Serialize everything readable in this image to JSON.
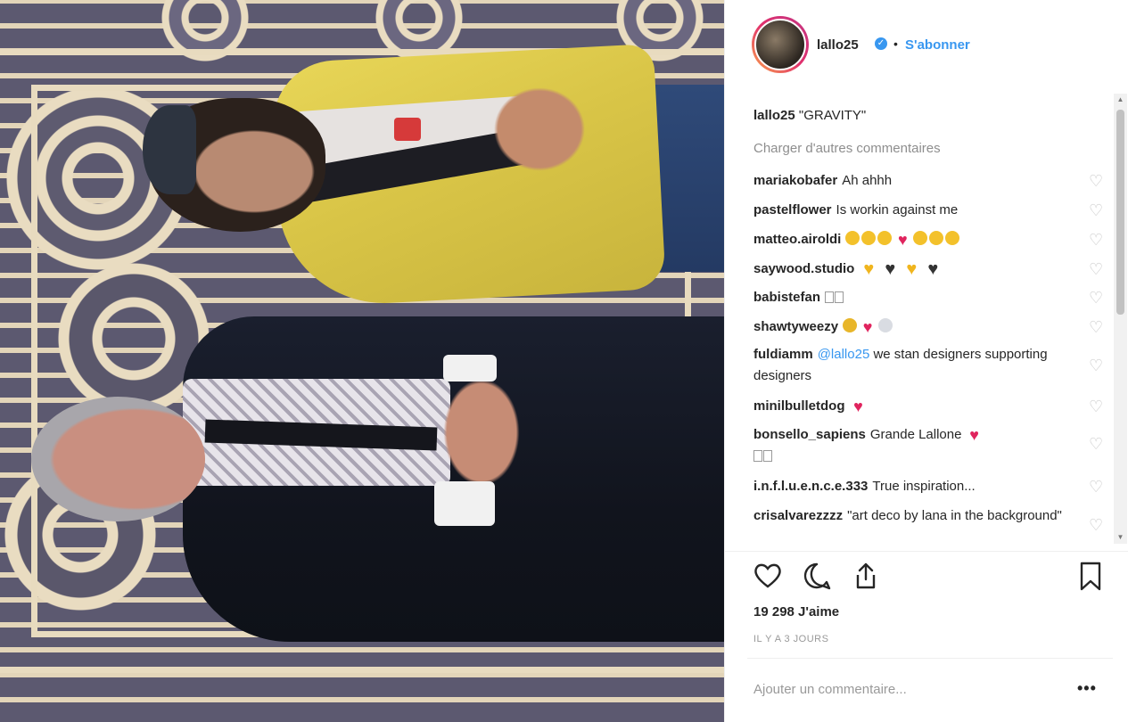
{
  "post": {
    "username": "lallo25",
    "verified_mark": "✓",
    "separator": "•",
    "follow_label": "S'abonner",
    "caption_user": "lallo25",
    "caption_text": "\"GRAVITY\"",
    "load_more": "Charger d'autres commentaires",
    "likes": "19 298 J'aime",
    "time_ago": "IL Y A 3 JOURS",
    "add_comment_placeholder": "Ajouter un commentaire...",
    "more_options": "•••"
  },
  "comments": [
    {
      "user": "mariakobafer",
      "text": "Ah ahhh"
    },
    {
      "user": "pastelflower",
      "text": "Is workin against me"
    },
    {
      "user": "matteo.airoldi",
      "text": "",
      "emojis": [
        "clap",
        "clap",
        "clap",
        "heart",
        "clap",
        "clap",
        "clap"
      ]
    },
    {
      "user": "saywood.studio",
      "text": "",
      "emojis": [
        "yheart",
        "bheart",
        "yheart",
        "bheart"
      ]
    },
    {
      "user": "babistefan",
      "text": "",
      "boxes": 2
    },
    {
      "user": "shawtyweezy",
      "text": "",
      "emojis": [
        "bee",
        "heart",
        "ring"
      ]
    },
    {
      "user": "fuldiamm",
      "mention": "@lallo25",
      "text": " we stan designers supporting designers"
    },
    {
      "user": "minilbulletdog",
      "text": "",
      "emojis": [
        "heart"
      ]
    },
    {
      "user": "bonsello_sapiens",
      "text": "Grande Lallone ",
      "emojis": [
        "heart"
      ],
      "boxes_after": 2
    },
    {
      "user": "i.n.f.l.u.e.n.c.e.333",
      "text": "True inspiration..."
    },
    {
      "user": "crisalvarezzzz",
      "text": "\"art deco by lana in the background\""
    }
  ],
  "icons": {
    "heart_outline": "♡",
    "scroll_up": "▲",
    "scroll_down": "▼"
  },
  "colors": {
    "link_blue": "#3897f0",
    "muted_grey": "#8e8e8e",
    "like_red": "#e0245e"
  }
}
